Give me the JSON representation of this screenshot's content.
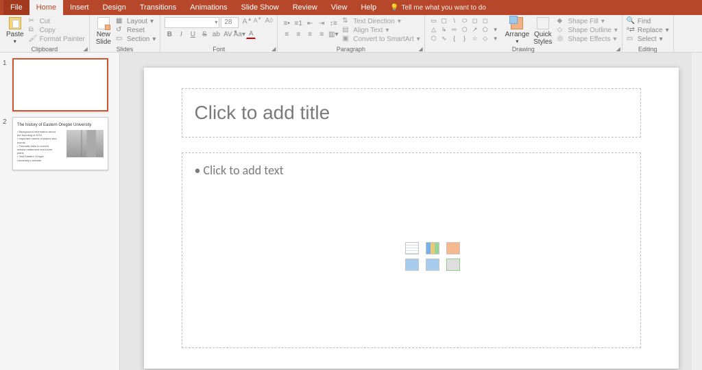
{
  "tabs": {
    "file": "File",
    "home": "Home",
    "insert": "Insert",
    "design": "Design",
    "transitions": "Transitions",
    "animations": "Animations",
    "slideshow": "Slide Show",
    "review": "Review",
    "view": "View",
    "help": "Help",
    "tellme": "Tell me what you want to do"
  },
  "ribbon": {
    "clipboard": {
      "label": "Clipboard",
      "paste": "Paste",
      "cut": "Cut",
      "copy": "Copy",
      "format_painter": "Format Painter"
    },
    "slides": {
      "label": "Slides",
      "new_slide": "New\nSlide",
      "layout": "Layout",
      "reset": "Reset",
      "section": "Section"
    },
    "font": {
      "label": "Font",
      "name": "",
      "size": "28"
    },
    "paragraph": {
      "label": "Paragraph",
      "text_direction": "Text Direction",
      "align_text": "Align Text",
      "convert_smartart": "Convert to SmartArt"
    },
    "drawing": {
      "label": "Drawing",
      "arrange": "Arrange",
      "quick_styles": "Quick\nStyles",
      "shape_fill": "Shape Fill",
      "shape_outline": "Shape Outline",
      "shape_effects": "Shape Effects"
    },
    "editing": {
      "label": "Editing",
      "find": "Find",
      "replace": "Replace",
      "select": "Select"
    }
  },
  "thumbs": {
    "n1": "1",
    "n2": "2",
    "slide2_title": "The history of Eastern Oregon University",
    "slide2_b1": "• Background information about the founding of EOU",
    "slide2_b2": "• Important names of places and events",
    "slide2_b3": "• Thematic links to current mission statement and future plans",
    "slide2_b4": "• Visit Eastern Oregon University's website"
  },
  "slide": {
    "title_placeholder": "Click to add title",
    "body_placeholder": "Click to add text"
  }
}
